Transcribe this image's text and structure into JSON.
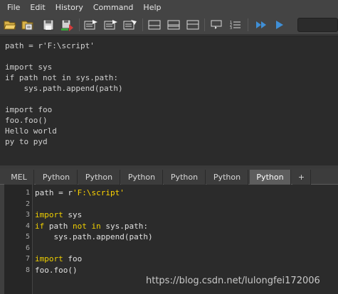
{
  "menubar": {
    "items": [
      "File",
      "Edit",
      "History",
      "Command",
      "Help"
    ]
  },
  "toolbar": {
    "icons": [
      "open-script-icon",
      "source-script-icon",
      "save-script-icon",
      "save-to-shelf-icon",
      "echo-all-commands-icon",
      "show-line-numbers-icon",
      "clear-history-icon",
      "show-history-only-icon",
      "show-both-icon",
      "show-input-only-icon",
      "show-stack-trace-icon",
      "line-numbers-icon",
      "execute-all-icon",
      "execute-icon"
    ],
    "colors": {
      "accent": "#3f8fd6",
      "icon": "#d8d8d8"
    }
  },
  "history": {
    "lines": [
      "path = r'F:\\script'",
      "",
      "import sys",
      "if path not in sys.path:",
      "    sys.path.append(path)",
      "",
      "import foo",
      "foo.foo()",
      "Hello world",
      "py to pyd"
    ]
  },
  "tabs": {
    "labels": [
      "MEL",
      "Python",
      "Python",
      "Python",
      "Python",
      "Python",
      "Python",
      "+"
    ],
    "active_index": 6
  },
  "editor": {
    "line_numbers": [
      "1",
      "2",
      "3",
      "4",
      "5",
      "6",
      "7",
      "8"
    ],
    "lines": [
      [
        {
          "t": "path = r",
          "c": "plain"
        },
        {
          "t": "'F:\\script'",
          "c": "str"
        }
      ],
      [],
      [
        {
          "t": "import",
          "c": "kw"
        },
        {
          "t": " sys",
          "c": "plain"
        }
      ],
      [
        {
          "t": "if",
          "c": "kw"
        },
        {
          "t": " path ",
          "c": "plain"
        },
        {
          "t": "not in",
          "c": "kw"
        },
        {
          "t": " sys.path:",
          "c": "plain"
        }
      ],
      [
        {
          "t": "    sys.path.append(path)",
          "c": "plain"
        }
      ],
      [],
      [
        {
          "t": "import",
          "c": "kw"
        },
        {
          "t": " foo",
          "c": "plain"
        }
      ],
      [
        {
          "t": "foo.foo()",
          "c": "plain"
        }
      ]
    ]
  },
  "watermark": "https://blog.csdn.net/lulongfei172006"
}
